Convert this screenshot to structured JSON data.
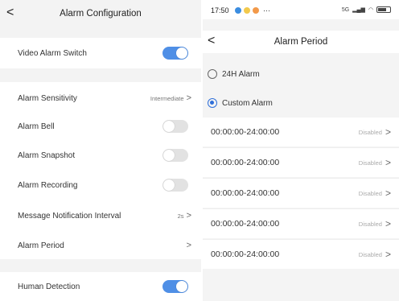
{
  "left": {
    "title": "Alarm Configuration",
    "back_glyph": "<",
    "items": [
      {
        "label": "Video Alarm Switch"
      },
      {
        "label": "Alarm Sensitivity",
        "value": "Intermediate"
      },
      {
        "label": "Alarm Bell"
      },
      {
        "label": "Alarm Snapshot"
      },
      {
        "label": "Alarm Recording"
      },
      {
        "label": "Message Notification Interval",
        "value": "2s"
      },
      {
        "label": "Alarm Period"
      },
      {
        "label": "Human Detection"
      }
    ],
    "chevron_glyph": ">"
  },
  "right": {
    "status_time": "17:50",
    "status_more": "···",
    "status_network": "5G",
    "title": "Alarm Period",
    "back_glyph": "<",
    "options": [
      {
        "label": "24H Alarm",
        "checked": false
      },
      {
        "label": "Custom Alarm",
        "checked": true
      }
    ],
    "periods": [
      {
        "range": "00:00:00-24:00:00",
        "state": "Disabled"
      },
      {
        "range": "00:00:00-24:00:00",
        "state": "Disabled"
      },
      {
        "range": "00:00:00-24:00:00",
        "state": "Disabled"
      },
      {
        "range": "00:00:00-24:00:00",
        "state": "Disabled"
      },
      {
        "range": "00:00:00-24:00:00",
        "state": "Disabled"
      }
    ],
    "chevron_glyph": ">"
  },
  "colors": {
    "switch_on": "#4f8fe6",
    "switch_off": "#e2e2e2",
    "radio_accent": "#2f6fd9"
  },
  "switches": {
    "video_alarm": "on",
    "alarm_bell": "off",
    "alarm_snapshot": "off",
    "alarm_recording": "off",
    "human_detection": "on"
  }
}
